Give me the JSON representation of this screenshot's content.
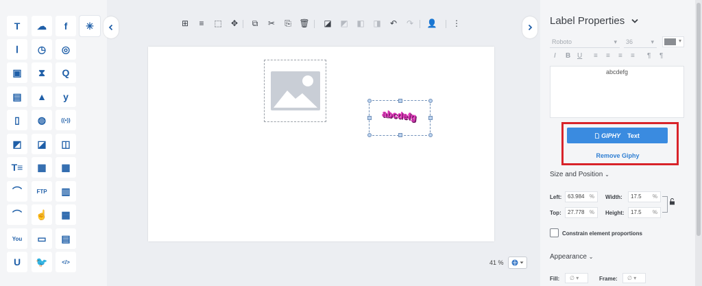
{
  "palette": [
    {
      "icon": "text-icon",
      "glyph": "T"
    },
    {
      "icon": "weather-icon",
      "glyph": "☁"
    },
    {
      "icon": "facebook-icon",
      "glyph": "f"
    },
    {
      "icon": "loading-spinner-icon",
      "glyph": "✳"
    },
    {
      "icon": "text-box-icon",
      "glyph": "Ⅰ"
    },
    {
      "icon": "clock-icon",
      "glyph": "◷"
    },
    {
      "icon": "instagram-icon",
      "glyph": "◎"
    },
    {
      "icon": "image-icon",
      "glyph": "▣"
    },
    {
      "icon": "hourglass-icon",
      "glyph": "⧗"
    },
    {
      "icon": "q-icon",
      "glyph": "Q"
    },
    {
      "icon": "video-icon",
      "glyph": "▤"
    },
    {
      "icon": "shapes-icon",
      "glyph": "▲"
    },
    {
      "icon": "yammer-icon",
      "glyph": "y"
    },
    {
      "icon": "pdf-icon",
      "glyph": "▯"
    },
    {
      "icon": "globe-icon",
      "glyph": "◍"
    },
    {
      "icon": "broadcast-icon",
      "glyph": "((•))"
    },
    {
      "icon": "gallery-icon",
      "glyph": "◩"
    },
    {
      "icon": "web-image-icon",
      "glyph": "◪"
    },
    {
      "icon": "ad-image-icon",
      "glyph": "◫"
    },
    {
      "icon": "text-scroll-icon",
      "glyph": "T≡"
    },
    {
      "icon": "web-grid-icon",
      "glyph": "▦"
    },
    {
      "icon": "calendar-icon",
      "glyph": "▦"
    },
    {
      "icon": "rss-icon",
      "glyph": "⌒"
    },
    {
      "icon": "ftp-icon",
      "glyph": "FTP"
    },
    {
      "icon": "bar-chart-icon",
      "glyph": "▥"
    },
    {
      "icon": "rss-image-icon",
      "glyph": "⌒"
    },
    {
      "icon": "touch-icon",
      "glyph": "☝"
    },
    {
      "icon": "table-icon",
      "glyph": "▦"
    },
    {
      "icon": "youtube-icon",
      "glyph": "You"
    },
    {
      "icon": "screen-icon",
      "glyph": "▭"
    },
    {
      "icon": "menu-board-icon",
      "glyph": "▤"
    },
    {
      "icon": "ustream-icon",
      "glyph": "U"
    },
    {
      "icon": "twitter-icon",
      "glyph": "🐦"
    },
    {
      "icon": "embed-code-icon",
      "glyph": "</>"
    }
  ],
  "toolbar": [
    {
      "icon": "grid-icon",
      "glyph": "⊞"
    },
    {
      "icon": "align-icon",
      "glyph": "≡"
    },
    {
      "icon": "select-frame-icon",
      "glyph": "⬚"
    },
    {
      "icon": "move-icon",
      "glyph": "✥"
    },
    {
      "icon": "copy-icon",
      "glyph": "⧉"
    },
    {
      "icon": "cut-icon",
      "glyph": "✂"
    },
    {
      "icon": "paste-icon",
      "glyph": "⎘"
    },
    {
      "icon": "delete-icon",
      "glyph": "🗑"
    },
    {
      "icon": "bring-front-icon",
      "glyph": "◪"
    },
    {
      "icon": "send-back-icon",
      "glyph": "◩"
    },
    {
      "icon": "bring-forward-icon",
      "glyph": "◧"
    },
    {
      "icon": "send-backward-icon",
      "glyph": "◨"
    },
    {
      "icon": "undo-icon",
      "glyph": "↶"
    },
    {
      "icon": "redo-icon",
      "glyph": "↷"
    },
    {
      "icon": "add-user-icon",
      "glyph": "👤"
    },
    {
      "icon": "more-vertical-icon",
      "glyph": "⋮"
    }
  ],
  "canvas": {
    "giphy_text": "abcdefg",
    "zoom": "41 %"
  },
  "props": {
    "title": "Label Properties",
    "font": "Roboto",
    "size": "36",
    "text_value": "abcdefg",
    "giphy_button": "Text",
    "giphy_logo": "GIPHY",
    "remove_giphy": "Remove Giphy",
    "size_position_heading": "Size and Position",
    "left_label": "Left:",
    "left_value": "63.984",
    "top_label": "Top:",
    "top_value": "27.778",
    "width_label": "Width:",
    "width_value": "17.5",
    "height_label": "Height:",
    "height_value": "17.5",
    "unit": "%",
    "constrain_label": "Constrain element proportions",
    "appearance_heading": "Appearance",
    "fill_label": "Fill:",
    "frame_label": "Frame:",
    "fill_value": "∅",
    "frame_value": "∅",
    "highlight_color": "#d8232a",
    "accent_color": "#3a8be0"
  }
}
